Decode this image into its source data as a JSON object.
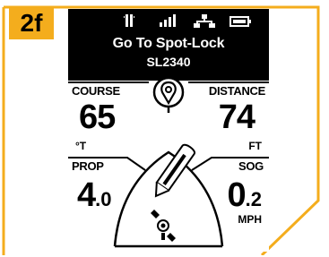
{
  "step_badge": "2f",
  "screen": {
    "title": "Go To Spot-Lock",
    "subtitle": "SL2340",
    "course": {
      "label": "COURSE",
      "value": "65",
      "unit": "°T"
    },
    "distance": {
      "label": "DISTANCE",
      "value": "74",
      "unit": "FT"
    },
    "prop": {
      "label": "PROP",
      "value_int": "4",
      "value_dec": ".0"
    },
    "sog": {
      "label": "SOG",
      "value_int": "0",
      "value_dec": ".2",
      "unit": "MPH"
    }
  },
  "status_icons": [
    "vibration-icon",
    "signal-bars-icon",
    "network-icon",
    "battery-icon"
  ],
  "colors": {
    "accent": "#f4ad1d",
    "screen_bg": "#000000"
  }
}
